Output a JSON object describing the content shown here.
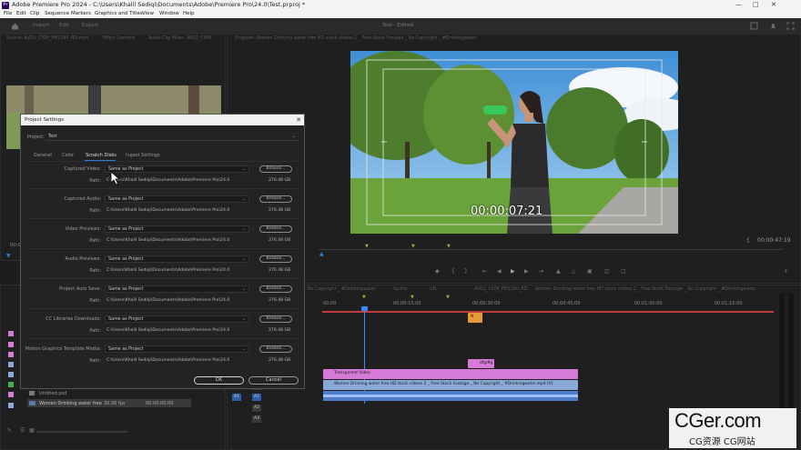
{
  "window": {
    "title": "Adobe Premiere Pro 2024 - C:\\Users\\Khalil Sediqi\\Documents\\Adobe\\Premiere Pro\\24.0\\Test.prproj *",
    "app_icon": "Pr"
  },
  "menu": [
    "File",
    "Edit",
    "Clip",
    "Sequence",
    "Markers",
    "Graphics and Titles",
    "View",
    "Window",
    "Help"
  ],
  "header": {
    "tabs": [
      "Import",
      "Edit",
      "Export"
    ],
    "document": "Test - Edited"
  },
  "source_panel": {
    "tabs": [
      "Source: AVD2_CI0M_PM1090_RD.mp4",
      "Effect Controls",
      "Audio Clip Mixer: AVD2_CI0M",
      "Metadata"
    ],
    "timecode": "00:0"
  },
  "program_panel": {
    "tab": "Program: Women Drinking water free HD stock videos 2 _ Free Stock Footage _ No Copyright _ #Drinkingwater",
    "overlay_timecode": "00:00:07:21",
    "duration": "00:00:47:19"
  },
  "dialog": {
    "title": "Project Settings",
    "project_label": "Project:",
    "project_value": "Test",
    "tabs": [
      "General",
      "Color",
      "Scratch Disks",
      "Ingest Settings"
    ],
    "active_tab": "Scratch Disks",
    "browse_label": "Browse...",
    "path_label": "Path:",
    "rows": [
      {
        "label": "Captured Video:",
        "value": "Same as Project",
        "path": "C:\\Users\\Khalil Sediqi\\Documents\\Adobe\\Premiere Pro\\24.0",
        "size": "276.48 GB"
      },
      {
        "label": "Captured Audio:",
        "value": "Same as Project",
        "path": "C:\\Users\\Khalil Sediqi\\Documents\\Adobe\\Premiere Pro\\24.0",
        "size": "276.48 GB"
      },
      {
        "label": "Video Previews:",
        "value": "Same as Project",
        "path": "C:\\Users\\Khalil Sediqi\\Documents\\Adobe\\Premiere Pro\\24.0",
        "size": "276.48 GB"
      },
      {
        "label": "Audio Previews:",
        "value": "Same as Project",
        "path": "C:\\Users\\Khalil Sediqi\\Documents\\Adobe\\Premiere Pro\\24.0",
        "size": "276.48 GB"
      },
      {
        "label": "Project Auto Save:",
        "value": "Same as Project",
        "path": "C:\\Users\\Khalil Sediqi\\Documents\\Adobe\\Premiere Pro\\24.0",
        "size": "276.48 GB"
      },
      {
        "label": "CC Libraries Downloads:",
        "value": "Same as Project",
        "path": "C:\\Users\\Khalil Sediqi\\Documents\\Adobe\\Premiere Pro\\24.0",
        "size": "276.48 GB"
      },
      {
        "label": "Motion Graphics Template Media:",
        "value": "Same as Project",
        "path": "C:\\Users\\Khalil Sediqi\\Documents\\Adobe\\Premiere Pro\\24.0",
        "size": "276.48 GB"
      }
    ],
    "ok_label": "OK",
    "cancel_label": "Cancel"
  },
  "project_panel": {
    "items": [
      {
        "name": "Untitled.psd",
        "rate": "",
        "start": ""
      },
      {
        "name": "Women Drinking water free",
        "rate": "30.00 fps",
        "start": "00:00:00:00"
      }
    ]
  },
  "timeline": {
    "tabs": [
      "No Copyright _ #Drinkingwater",
      "Sports",
      "UN",
      "AVD2_CI0M_PM1090_RD",
      "Women Drinking water free HD stock videos 2 _ Free Stock Footage _ No Copyright _ #Drinkingwater"
    ],
    "ruler": [
      "00:00",
      "00:00:15:00",
      "00:00:30:00",
      "00:00:45:00",
      "00:01:00:00",
      "00:01:15:00"
    ],
    "clips": {
      "n_clip": "N",
      "dfgdfg": "dfgdfg",
      "transparent_video": "Transparent Video",
      "video_clip": "Women Drinking water free HD stock videos 2 _ Free Stock Footage _ No Copyright _ #Drinkingwater.mp4 [V]"
    },
    "track_labels": [
      "V1",
      "A1",
      "A2",
      "A3"
    ]
  },
  "watermark": {
    "logo": "CGer.com",
    "subtitle": "CG资源 CG网站"
  },
  "colors": {
    "accent_blue": "#2f7bd8",
    "clip_pink": "#d57ad6",
    "clip_blue": "#8aa8d8",
    "clip_orange": "#e69a3a",
    "playhead": "#3b8bff"
  }
}
